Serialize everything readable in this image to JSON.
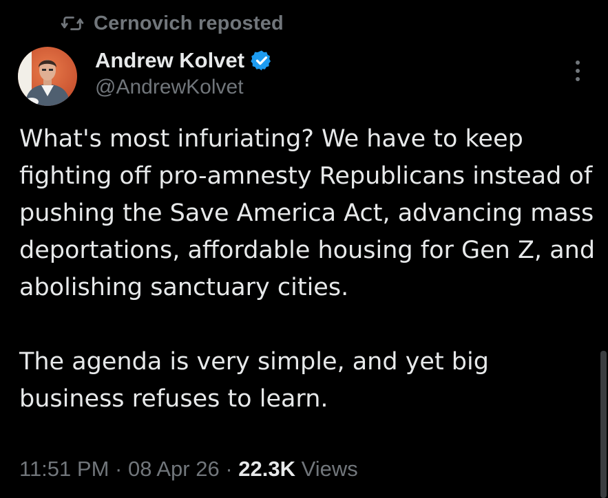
{
  "repost": {
    "icon": "repost-icon",
    "label": "Cernovich reposted"
  },
  "author": {
    "avatar_icon": "avatar",
    "display_name": "Andrew Kolvet",
    "verified_icon": "verified-badge-icon",
    "handle": "@AndrewKolvet"
  },
  "menu": {
    "icon": "more-options-icon"
  },
  "tweet": {
    "paragraphs": [
      "What's most infuriating? We have to keep fighting off pro-amnesty Republicans instead of pushing the Save America Act, advancing mass deportations, affordable housing for Gen Z, and abolishing sanctuary cities.",
      "The agenda is very simple, and yet big business refuses to learn."
    ]
  },
  "meta": {
    "time": "11:51 PM",
    "separator": "·",
    "date": "08 Apr 26",
    "views_count": "22.3K",
    "views_label": "Views"
  },
  "colors": {
    "background": "#000000",
    "text_primary": "#e7e9ea",
    "text_secondary": "#71767b",
    "verified": "#1d9bf0"
  }
}
